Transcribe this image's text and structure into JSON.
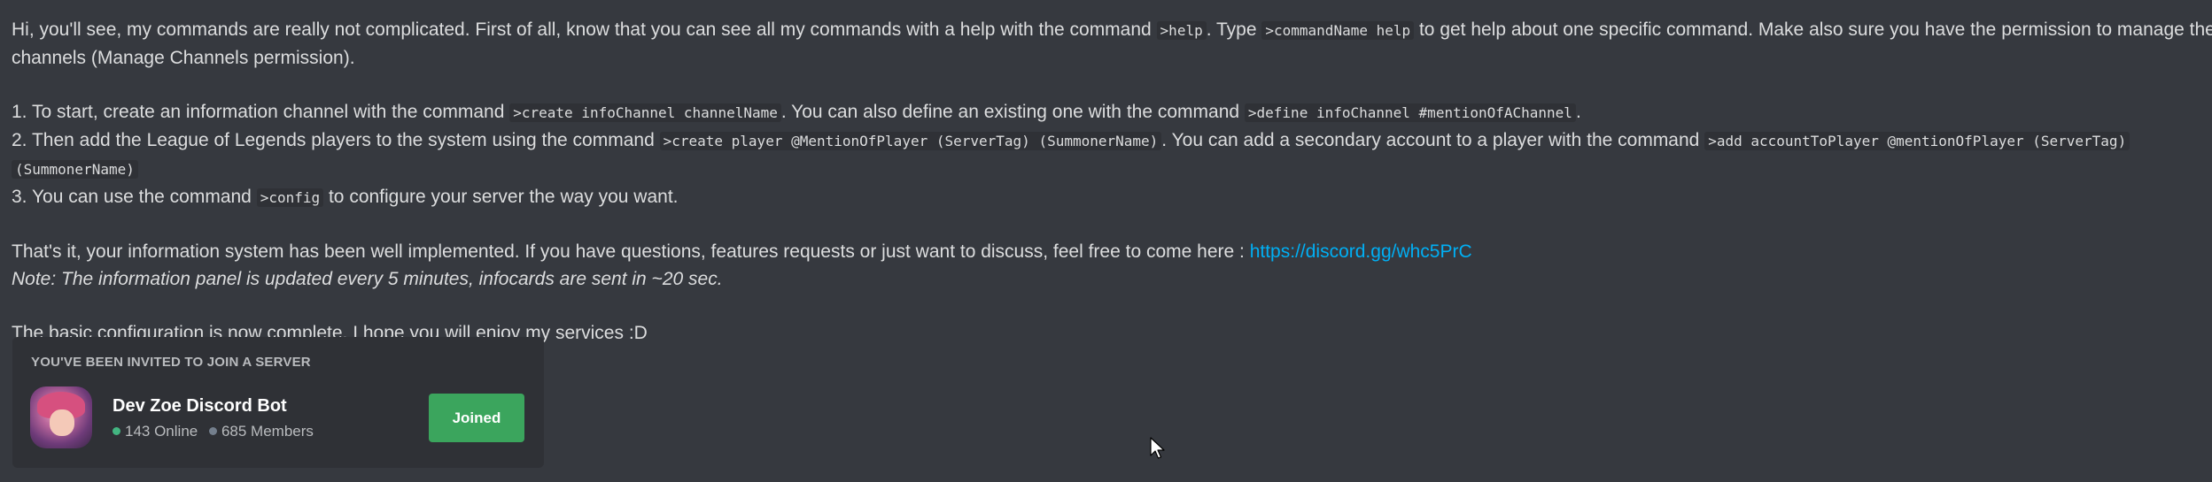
{
  "message": {
    "intro_1": "Hi, you'll see, my commands are really not complicated. First of all, know that you can see all my commands with a help with the command ",
    "intro_cmd_help": ">help",
    "intro_2": ". Type ",
    "intro_cmd_specific": ">commandName help",
    "intro_3": " to get help about one specific command. Make also sure you have the permission to manage the",
    "intro_4": "channels (Manage Channels permission).",
    "step1_a": "1. To start, create an information channel with the command ",
    "step1_cmd_create": ">create infoChannel channelName",
    "step1_b": ". You can also define an existing one with the command ",
    "step1_cmd_define": ">define infoChannel #mentionOfAChannel",
    "step1_c": ".",
    "step2_a": "2. Then add the League of Legends players to the system using the command ",
    "step2_cmd_player": ">create player @MentionOfPlayer (ServerTag) (SummonerName)",
    "step2_b": ". You can add a secondary account to a player with the command ",
    "step2_cmd_account": ">add accountToPlayer @mentionOfPlayer (ServerTag)",
    "step2_cmd_account_cont": "(SummonerName)",
    "step3_a": "3. You can use the command ",
    "step3_cmd_config": ">config",
    "step3_b": " to configure your server the way you want.",
    "outro_1": "That's it, your information system has been well implemented. If you have questions, features requests or just want to discuss, feel free to come here : ",
    "outro_link": "https://discord.gg/whc5PrC",
    "note": "Note: The information panel is updated every 5 minutes, infocards are sent in ~20 sec.",
    "closing": "The basic configuration is now complete. I hope you will enjoy my services :D"
  },
  "invite": {
    "header": "YOU'VE BEEN INVITED TO JOIN A SERVER",
    "server_name": "Dev Zoe Discord Bot",
    "online": "143 Online",
    "members": "685 Members",
    "button_label": "Joined"
  },
  "colors": {
    "background": "#36393f",
    "link": "#00aff4",
    "joined_button": "#3ba55d",
    "online_dot": "#43b581",
    "members_dot": "#747f8d"
  },
  "icons": {
    "server_avatar": "server-avatar-icon",
    "cursor": "mouse-pointer-icon"
  }
}
